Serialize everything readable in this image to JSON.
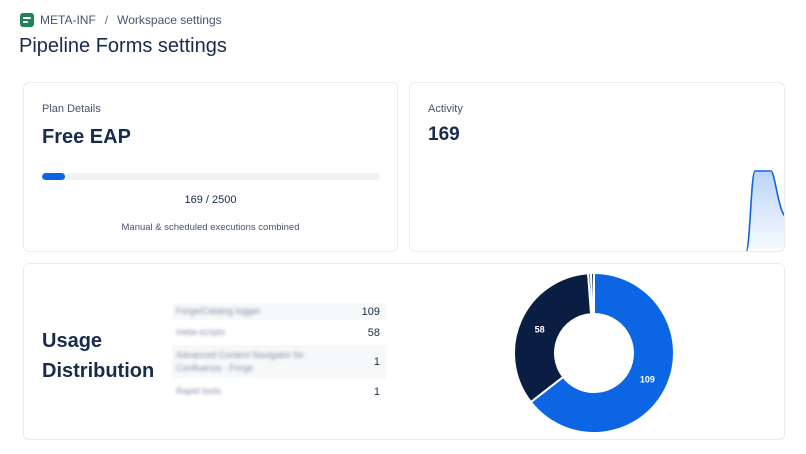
{
  "breadcrumb": {
    "icon": "workspace-app-icon",
    "items": [
      "META-INF",
      "Workspace settings"
    ],
    "separator": "/"
  },
  "page": {
    "title": "Pipeline Forms settings"
  },
  "plan": {
    "label": "Plan Details",
    "name": "Free EAP",
    "used": 169,
    "limit": 2500,
    "usage_text": "169 / 2500",
    "caption": "Manual & scheduled executions combined",
    "bar_color": "#0c66e4"
  },
  "activity": {
    "label": "Activity",
    "value": "169",
    "series_color": "#0c66e4"
  },
  "usage": {
    "title_line1": "Usage",
    "title_line2": "Distribution",
    "rows": [
      {
        "name": "Forge/Catalog logger",
        "count": "109"
      },
      {
        "name": "meta-scripts",
        "count": "58"
      },
      {
        "name": "Advanced Content Navigator for Confluence - Forge",
        "count": "1"
      },
      {
        "name": "Rapid tools",
        "count": "1"
      }
    ]
  },
  "chart_data": {
    "type": "pie",
    "categories": [
      "Forge/Catalog logger",
      "meta-scripts",
      "Advanced Content Navigator for Confluence - Forge",
      "Rapid tools"
    ],
    "values": [
      109,
      58,
      1,
      1
    ],
    "data_labels": [
      "109",
      "58",
      "",
      ""
    ],
    "colors": [
      "#0c66e4",
      "#091e42",
      "#0c66e4",
      "#091e42"
    ],
    "donut": true
  }
}
